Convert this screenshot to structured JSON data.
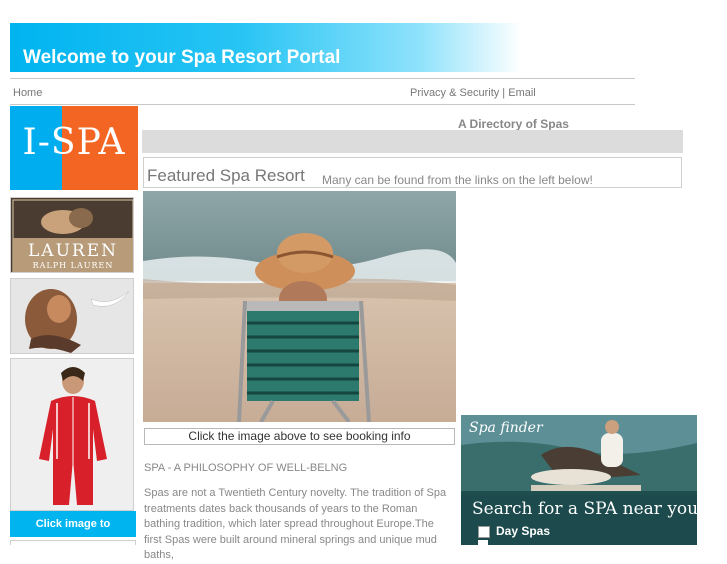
{
  "header": {
    "title": "Welcome to your Spa Resort Portal"
  },
  "nav": {
    "home": "Home",
    "privacy": "Privacy & Security",
    "separator": " | ",
    "email": "Email"
  },
  "logo": {
    "text": "I-SPA",
    "colors": {
      "blue": "#00aeef",
      "orange": "#f26522"
    }
  },
  "directory": {
    "title": "A Directory of Spas"
  },
  "featured": {
    "title": "Featured Spa Resort",
    "subtitle": "Many can be found from the links on the left below!",
    "caption": "Click the image above to see booking info"
  },
  "ads": {
    "ad1_brand": "LAUREN",
    "ad1_sub": "RALPH LAUREN",
    "buy_label": "Click image to purchase"
  },
  "article": {
    "title": "SPA - A PHILOSOPHY OF WELL-BELNG",
    "body": "Spas are not a Twentieth Century novelty. The tradition of Spa treatments dates back thousands of years to the Roman bathing tradition, which later spread throughout Europe.The first Spas were built around mineral springs and unique mud baths,"
  },
  "spafinder": {
    "logo": "Spa finder",
    "search_text": "Search for a SPA near you:",
    "options": [
      "Day Spas"
    ]
  },
  "colors": {
    "accent": "#00b4f0",
    "text_gray": "#888888"
  }
}
